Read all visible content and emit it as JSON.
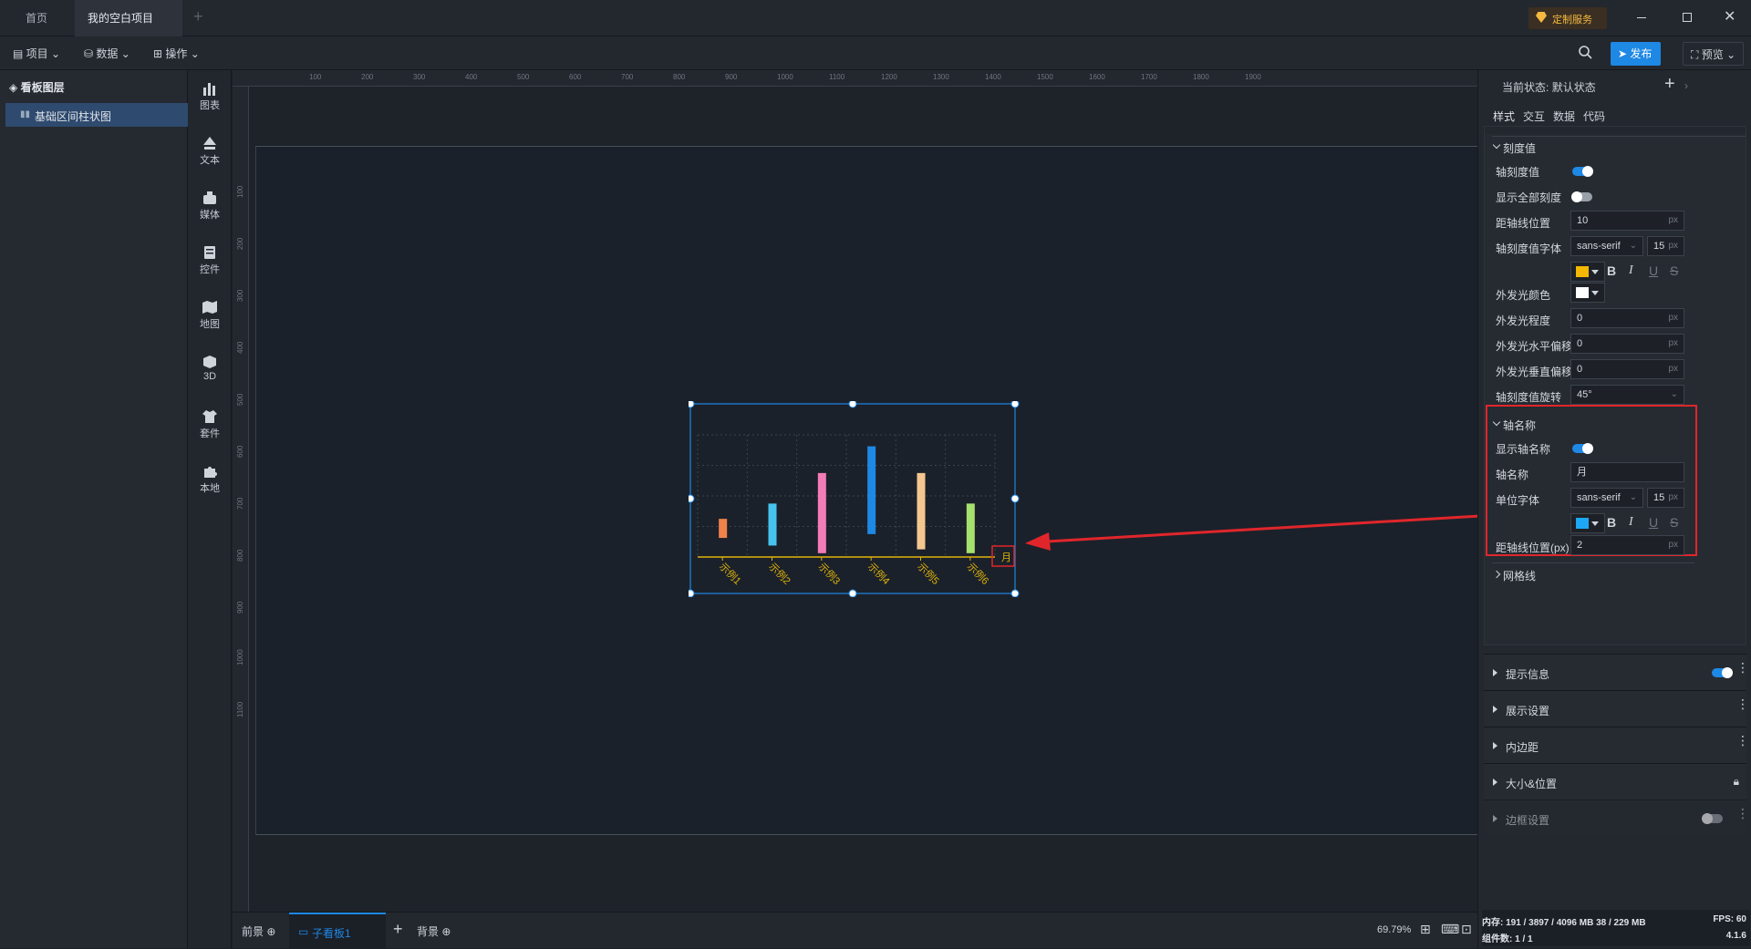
{
  "tabs": [
    {
      "label": "首页"
    },
    {
      "label": "我的空白项目"
    }
  ],
  "window": {
    "custom_service": "定制服务"
  },
  "toolbar": {
    "project": "项目",
    "data": "数据",
    "operate": "操作",
    "publish": "发布",
    "preview": "预览"
  },
  "layers": {
    "title": "看板图层",
    "items": [
      {
        "label": "基础区间柱状图"
      }
    ]
  },
  "components": [
    {
      "label": "图表"
    },
    {
      "label": "文本"
    },
    {
      "label": "媒体"
    },
    {
      "label": "控件"
    },
    {
      "label": "地图"
    },
    {
      "label": "3D"
    },
    {
      "label": "套件"
    },
    {
      "label": "本地"
    }
  ],
  "ruler": {
    "top": [
      "100",
      "200",
      "300",
      "400",
      "500",
      "600",
      "700",
      "800",
      "900",
      "1000",
      "1100",
      "1200",
      "1300",
      "1400",
      "1500",
      "1600",
      "1700",
      "1800",
      "1900"
    ],
    "left": [
      "100",
      "200",
      "300",
      "400",
      "500",
      "600",
      "700",
      "800",
      "900",
      "1000",
      "1100"
    ]
  },
  "chart_data": {
    "type": "bar",
    "categories": [
      "示例1",
      "示例2",
      "示例3",
      "示例4",
      "示例5",
      "示例6"
    ],
    "ranges": [
      [
        5,
        10
      ],
      [
        3,
        14
      ],
      [
        1,
        22
      ],
      [
        6,
        29
      ],
      [
        2,
        22
      ],
      [
        1,
        14
      ]
    ],
    "colors": [
      "#f0834a",
      "#47c3f0",
      "#f27cb8",
      "#1e88e5",
      "#f5c78e",
      "#a6e06e"
    ],
    "axis_name": "月",
    "xlabel_rotation": "45°",
    "axis_color": "#e0b40a",
    "ylim": [
      0,
      32
    ],
    "grid": true
  },
  "bottom": {
    "foreground": "前景",
    "subboard": "子看板1",
    "background": "背景",
    "zoom": "69.79%"
  },
  "panel": {
    "state_label": "当前状态:",
    "state_value": "默认状态",
    "tabs": [
      "样式",
      "交互",
      "数据",
      "代码"
    ],
    "tick_section": "刻度值",
    "rows": {
      "axis_tick": "轴刻度值",
      "show_all_ticks": "显示全部刻度",
      "distance_axis": "距轴线位置",
      "distance_axis_value": "10",
      "tick_font": "轴刻度值字体",
      "tick_font_value": "sans-serif",
      "tick_font_size": "15",
      "tick_color": "#f5b800",
      "glow_color": "外发光颜色",
      "glow_color_value": "#ffffff",
      "glow_degree": "外发光程度",
      "glow_degree_value": "0",
      "glow_h": "外发光水平偏移",
      "glow_h_value": "0",
      "glow_v": "外发光垂直偏移",
      "glow_v_value": "0",
      "tick_rotate": "轴刻度值旋转",
      "tick_rotate_value": "45°"
    },
    "axis_name_section": "轴名称",
    "axis_name_rows": {
      "show_axis_name": "显示轴名称",
      "axis_name": "轴名称",
      "axis_name_value": "月",
      "unit_font": "单位字体",
      "unit_font_value": "sans-serif",
      "unit_font_size": "15",
      "unit_color": "#1ea7f5",
      "distance": "距轴线位置(px)",
      "distance_value": "2"
    },
    "grid_section": "网格线",
    "unit_px": "px",
    "sections": [
      {
        "label": "提示信息"
      },
      {
        "label": "展示设置"
      },
      {
        "label": "内边距"
      },
      {
        "label": "大小&位置"
      },
      {
        "label": "边框设置"
      }
    ],
    "status": {
      "memory": "内存: 191 / 3897 / 4096 MB 38 / 229 MB",
      "fps": "FPS: 60",
      "components": "组件数: 1 / 1",
      "version": "4.1.6"
    }
  },
  "highlight_color": "#e0262b"
}
